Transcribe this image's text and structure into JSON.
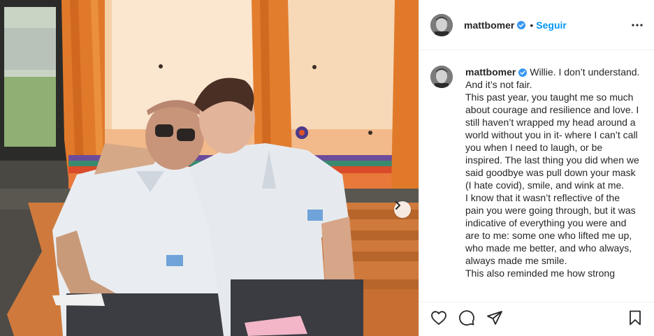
{
  "post": {
    "author": {
      "username": "mattbomer",
      "verified": true
    },
    "follow_label": "Seguir",
    "separator": "•",
    "caption": {
      "lines": [
        "Willie. I don’t understand. And it’s not fair.",
        "This past year, you taught me so much about courage and resilience and love. I still haven’t wrapped my head around a world without you in it- where I can’t call you when I need to laugh, or be inspired. The last thing you did when we said goodbye was pull down your mask (I hate covid), smile, and wink at me.",
        "I know that it wasn’t reflective of the pain you were going through, but it was indicative of everything you were and are to me: some one who lifted me up, who made me better, and who always, always made me smile.",
        "This also reminded me how strong"
      ]
    }
  },
  "icons": {
    "verified": "verified-badge-icon",
    "more": "more-options-icon",
    "next": "chevron-right-icon",
    "like": "heart-icon",
    "comment": "comment-icon",
    "share": "paper-plane-icon",
    "save": "bookmark-icon"
  },
  "colors": {
    "accent": "#0095f6",
    "verified": "#3897f0",
    "text": "#262626",
    "border": "#efefef"
  }
}
